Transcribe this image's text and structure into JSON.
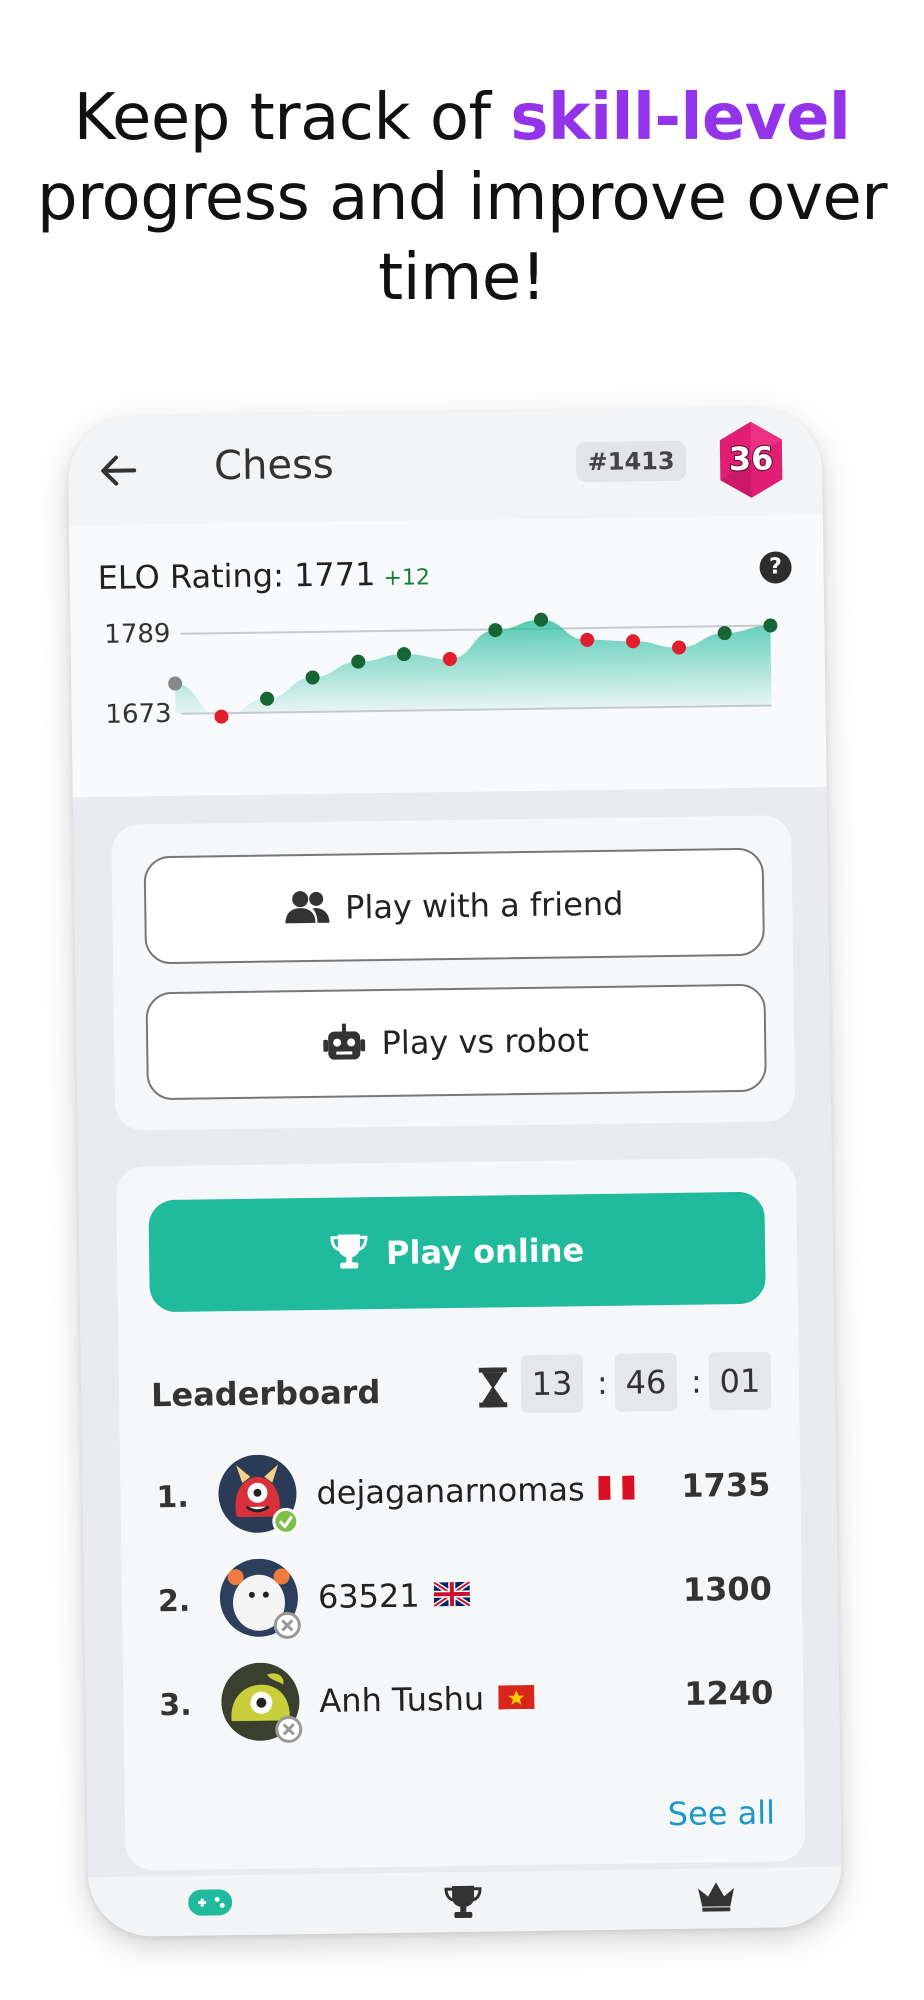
{
  "headline": {
    "part1": "Keep track of ",
    "highlight": "skill-level",
    "part2": " progress and improve over time!"
  },
  "appbar": {
    "title": "Chess",
    "rank": "#1413",
    "level": "36"
  },
  "rating": {
    "label": "ELO Rating: 1771",
    "delta": "+12",
    "help": "?"
  },
  "chart_data": {
    "type": "line",
    "y_ticks": [
      "1789",
      "1673"
    ],
    "ylim": [
      1673,
      1789
    ],
    "x": [
      1,
      2,
      3,
      4,
      5,
      6,
      7,
      8,
      9,
      10,
      11,
      12,
      13,
      14
    ],
    "values": [
      1717,
      1668,
      1693,
      1723,
      1745,
      1755,
      1747,
      1788,
      1802,
      1772,
      1769,
      1759,
      1779,
      1789
    ],
    "point_colors": [
      "#888888",
      "#e11d2e",
      "#166534",
      "#166534",
      "#166534",
      "#166534",
      "#e11d2e",
      "#166534",
      "#166534",
      "#e11d2e",
      "#e11d2e",
      "#e11d2e",
      "#166534",
      "#166534"
    ],
    "colors": {
      "gain": "#166534",
      "loss": "#e11d2e",
      "start": "#888888",
      "area": "#1fbb9c"
    }
  },
  "buttons": {
    "friend": "Play with a friend",
    "robot": "Play vs robot",
    "online": "Play online"
  },
  "leaderboard": {
    "title": "Leaderboard",
    "timer": {
      "h": "13",
      "m": "46",
      "s": "01",
      "sep": ":"
    },
    "rows": [
      {
        "rank": "1.",
        "name": "dejaganarnomas",
        "score": "1735",
        "flag": "peru",
        "status": "online"
      },
      {
        "rank": "2.",
        "name": "63521",
        "score": "1300",
        "flag": "uk",
        "status": "offline"
      },
      {
        "rank": "3.",
        "name": "Anh Tushu",
        "score": "1240",
        "flag": "vietnam",
        "status": "offline"
      }
    ],
    "see_all": "See all"
  },
  "nav": {
    "items": [
      "gamepad-icon",
      "trophy-icon",
      "crown-icon"
    ],
    "active_color": "#1fbb9c"
  },
  "colors": {
    "accent": "#1fbb9c",
    "highlight": "#9333ea",
    "link": "#1a98c9",
    "badge": "#e11d74"
  }
}
